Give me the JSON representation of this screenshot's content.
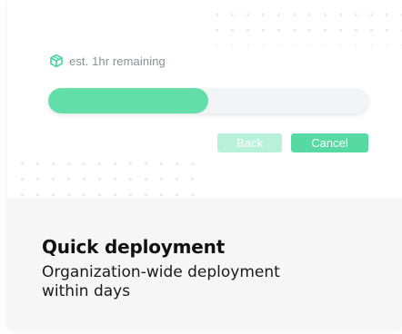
{
  "status": {
    "icon": "cube-icon",
    "text": "est. 1hr remaining"
  },
  "progress": {
    "fraction": 0.5
  },
  "buttons": {
    "back_label": "Back",
    "cancel_label": "Cancel"
  },
  "feature": {
    "title": "Quick deployment",
    "description": "Organization-wide deployment within days"
  },
  "colors": {
    "accent": "#56d9a3",
    "accent_light": "#b8f1d9",
    "progress_fill": "#62dfa9",
    "muted_text": "#8a8f96",
    "panel_bg": "#f6f6f7"
  }
}
